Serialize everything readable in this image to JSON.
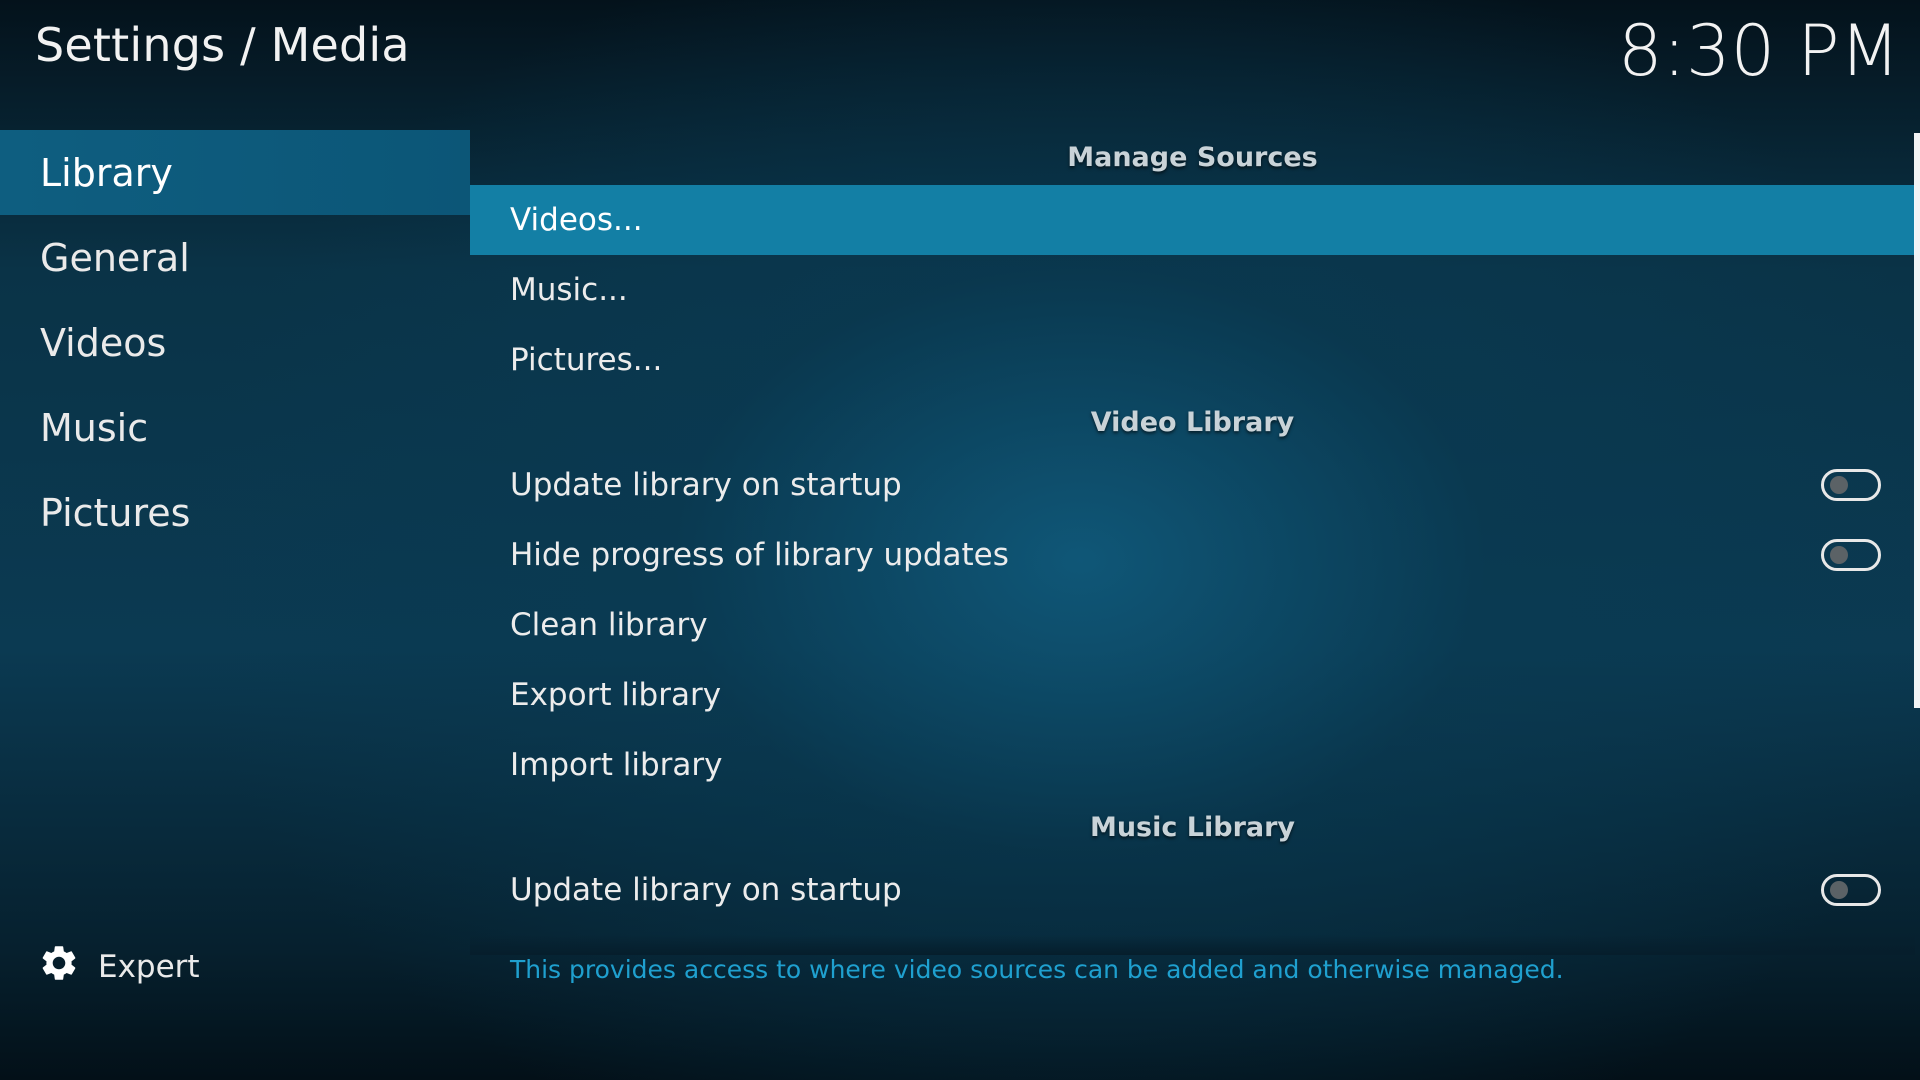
{
  "header": {
    "title": "Settings / Media",
    "clock": "8:30 PM"
  },
  "sidebar": {
    "items": [
      {
        "label": "Library",
        "active": true
      },
      {
        "label": "General",
        "active": false
      },
      {
        "label": "Videos",
        "active": false
      },
      {
        "label": "Music",
        "active": false
      },
      {
        "label": "Pictures",
        "active": false
      }
    ],
    "expert_label": "Expert",
    "expert_icon": "gear-icon"
  },
  "content": {
    "sections": {
      "manage_sources": {
        "title": "Manage Sources",
        "items": [
          "Videos...",
          "Music...",
          "Pictures..."
        ]
      },
      "video_library": {
        "title": "Video Library",
        "items": [
          {
            "label": "Update library on startup",
            "toggle": false
          },
          {
            "label": "Hide progress of library updates",
            "toggle": false
          },
          {
            "label": "Clean library"
          },
          {
            "label": "Export library"
          },
          {
            "label": "Import library"
          }
        ]
      },
      "music_library": {
        "title": "Music Library",
        "items": [
          {
            "label": "Update library on startup",
            "toggle": false
          }
        ]
      }
    }
  },
  "description": "This provides access to where video sources can be added and otherwise managed.",
  "colors": {
    "focus": "#137fa5",
    "sidebar_active": "#0e5e80",
    "description_text": "#1fa0cf"
  }
}
